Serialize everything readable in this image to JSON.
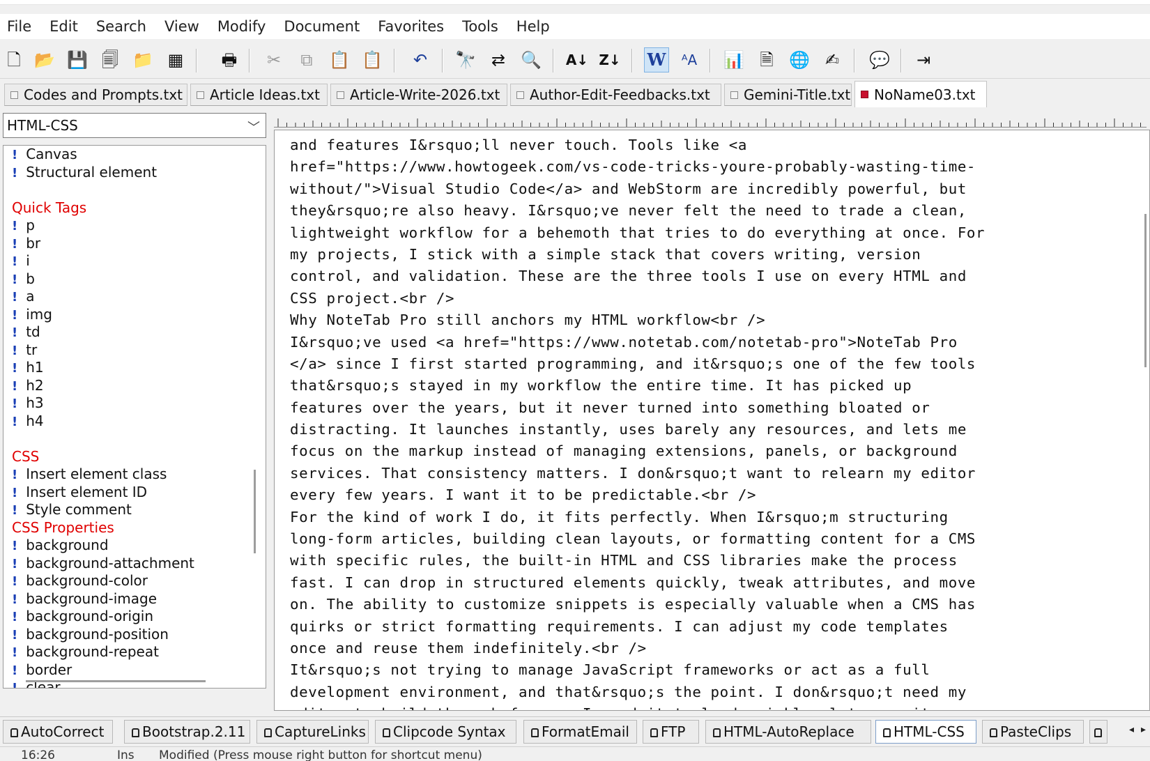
{
  "menu": [
    "File",
    "Edit",
    "Search",
    "View",
    "Modify",
    "Document",
    "Favorites",
    "Tools",
    "Help"
  ],
  "toolbar_icons": [
    "new-document-icon",
    "open-folder-icon",
    "save-icon",
    "save-all-icon",
    "open-favorite-icon",
    "paste-new-icon",
    "print-icon",
    "cut-icon",
    "copy-icon",
    "paste-icon",
    "paste-special-icon",
    "undo-icon",
    "find-icon",
    "replace-icon",
    "find-in-files-icon",
    "sort-ascending-icon",
    "sort-descending-icon",
    "word-wrap-icon",
    "font-size-icon",
    "statistics-icon",
    "document-properties-icon",
    "browser-preview-icon",
    "spell-check-icon",
    "comment-icon",
    "exit-icon"
  ],
  "doc_tabs": [
    {
      "label": "Codes and Prompts.txt",
      "active": false
    },
    {
      "label": "Article Ideas.txt",
      "active": false
    },
    {
      "label": "Article-Write-2026.txt",
      "active": false
    },
    {
      "label": "Author-Edit-Feedbacks.txt",
      "active": false
    },
    {
      "label": "Gemini-Title.txt",
      "active": false
    },
    {
      "label": "NoName03.txt",
      "active": true
    }
  ],
  "sidebar": {
    "library": "HTML-CSS",
    "items": [
      {
        "kind": "clip",
        "label": "Canvas"
      },
      {
        "kind": "clip",
        "label": "Structural element"
      },
      {
        "kind": "gap"
      },
      {
        "kind": "header",
        "label": "Quick Tags"
      },
      {
        "kind": "clip",
        "label": "p"
      },
      {
        "kind": "clip",
        "label": "br"
      },
      {
        "kind": "clip",
        "label": "i"
      },
      {
        "kind": "clip",
        "label": "b"
      },
      {
        "kind": "clip",
        "label": "a"
      },
      {
        "kind": "clip",
        "label": "img"
      },
      {
        "kind": "clip",
        "label": "td"
      },
      {
        "kind": "clip",
        "label": "tr"
      },
      {
        "kind": "clip",
        "label": "h1"
      },
      {
        "kind": "clip",
        "label": "h2"
      },
      {
        "kind": "clip",
        "label": "h3"
      },
      {
        "kind": "clip",
        "label": "h4"
      },
      {
        "kind": "gap"
      },
      {
        "kind": "header",
        "label": "CSS"
      },
      {
        "kind": "clip",
        "label": "Insert element class"
      },
      {
        "kind": "clip",
        "label": "Insert element ID"
      },
      {
        "kind": "clip",
        "label": "Style comment"
      },
      {
        "kind": "header",
        "label": "CSS Properties"
      },
      {
        "kind": "clip",
        "label": "background"
      },
      {
        "kind": "clip",
        "label": "background-attachment"
      },
      {
        "kind": "clip",
        "label": "background-color"
      },
      {
        "kind": "clip",
        "label": "background-image"
      },
      {
        "kind": "clip",
        "label": "background-origin"
      },
      {
        "kind": "clip",
        "label": "background-position"
      },
      {
        "kind": "clip",
        "label": "background-repeat"
      },
      {
        "kind": "clip",
        "label": "border"
      },
      {
        "kind": "clip",
        "label": "clear"
      }
    ]
  },
  "editor_lines": [
    "and features I&rsquo;ll never touch. Tools like <a",
    "href=\"https://www.howtogeek.com/vs-code-tricks-youre-probably-wasting-time-",
    "without/\">Visual Studio Code</a> and WebStorm are incredibly powerful, but",
    "they&rsquo;re also heavy. I&rsquo;ve never felt the need to trade a clean,",
    "lightweight workflow for a behemoth that tries to do everything at once. For",
    "my projects, I stick with a simple stack that covers writing, version",
    "control, and validation. These are the three tools I use on every HTML and",
    "CSS project.<br />",
    "Why NoteTab Pro still anchors my HTML workflow<br />",
    "I&rsquo;ve used <a href=\"https://www.notetab.com/notetab-pro\">NoteTab Pro",
    "</a> since I first started programming, and it&rsquo;s one of the few tools",
    "that&rsquo;s stayed in my workflow the entire time. It has picked up",
    "features over the years, but it never turned into something bloated or",
    "distracting. It launches instantly, uses barely any resources, and lets me",
    "focus on the markup instead of managing extensions, panels, or background",
    "services. That consistency matters. I don&rsquo;t want to relearn my editor",
    "every few years. I want it to be predictable.<br />",
    "For the kind of work I do, it fits perfectly. When I&rsquo;m structuring",
    "long-form articles, building clean layouts, or formatting content for a CMS",
    "with specific rules, the built-in HTML and CSS libraries make the process",
    "fast. I can drop in structured elements quickly, tweak attributes, and move",
    "on. The ability to customize snippets is especially valuable when a CMS has",
    "quirks or strict formatting requirements. I can adjust my code templates",
    "once and reuse them indefinitely.<br />",
    "It&rsquo;s not trying to manage JavaScript frameworks or act as a full",
    "development environment, and that&rsquo;s the point. I don&rsquo;t need my",
    "editor to build the web for me. I need it to load quickly, let me write"
  ],
  "clipbook_tabs": [
    {
      "label": "AutoCorrect",
      "active": false
    },
    {
      "label": "Bootstrap.2.11",
      "active": false
    },
    {
      "label": "CaptureLinks",
      "active": false
    },
    {
      "label": "Clipcode Syntax",
      "active": false
    },
    {
      "label": "FormatEmail",
      "active": false
    },
    {
      "label": "FTP",
      "active": false
    },
    {
      "label": "HTML-AutoReplace",
      "active": false
    },
    {
      "label": "HTML-CSS",
      "active": true
    },
    {
      "label": "PasteClips",
      "active": false
    },
    {
      "label": "",
      "active": false
    }
  ],
  "status": {
    "position": "16:26",
    "mode": "Ins",
    "message": "Modified  (Press mouse right button for shortcut menu)"
  }
}
